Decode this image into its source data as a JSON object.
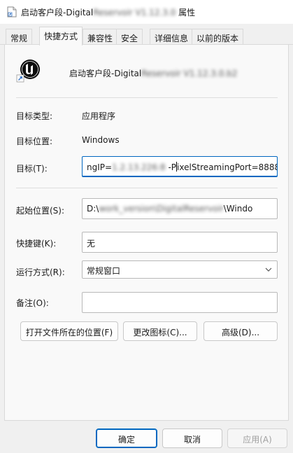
{
  "window": {
    "title_prefix": "启动客户段-Digital",
    "title_obscured": "Reservoir V1.12.3.0",
    "title_suffix": " 属性"
  },
  "tabs": [
    {
      "label": "常规",
      "active": false
    },
    {
      "label": "快捷方式",
      "active": true
    },
    {
      "label": "兼容性",
      "active": false
    },
    {
      "label": "安全",
      "active": false
    },
    {
      "label": "详细信息",
      "active": false
    },
    {
      "label": "以前的版本",
      "active": false
    }
  ],
  "shortcut": {
    "name_prefix": "启动客户段-Digital",
    "name_obscured": "Reservoir V1.12.3.0.b2",
    "target_type_label": "目标类型:",
    "target_type_value": "应用程序",
    "target_location_label": "目标位置:",
    "target_location_value": "Windows",
    "target_label": "目标(T):",
    "target_value_prefix": "ngIP=",
    "target_value_obscured": "1.2.13.226:8",
    "target_value_mid": " -P",
    "target_value_suffix": "ixelStreamingPort=8888",
    "start_in_label": "起始位置(S):",
    "start_in_prefix": "D:\\",
    "start_in_obscured": "work_version\\DigitalReservoir",
    "start_in_suffix": "\\Windo",
    "hotkey_label": "快捷键(K):",
    "hotkey_value": "无",
    "run_label": "运行方式(R):",
    "run_value": "常规窗口",
    "comment_label": "备注(O):",
    "comment_value": "",
    "open_location_button": "打开文件所在的位置(F)",
    "change_icon_button": "更改图标(C)...",
    "advanced_button": "高级(D)..."
  },
  "footer": {
    "ok": "确定",
    "cancel": "取消",
    "apply": "应用(A)"
  },
  "colors": {
    "accent": "#0067c0",
    "panel": "#f9f9f9",
    "window_bg": "#f0f0f0"
  },
  "icons": {
    "title": "shortcut-file-icon",
    "app": "unreal-engine-icon",
    "overlay": "shortcut-arrow-icon",
    "dropdown": "chevron-down-icon"
  }
}
